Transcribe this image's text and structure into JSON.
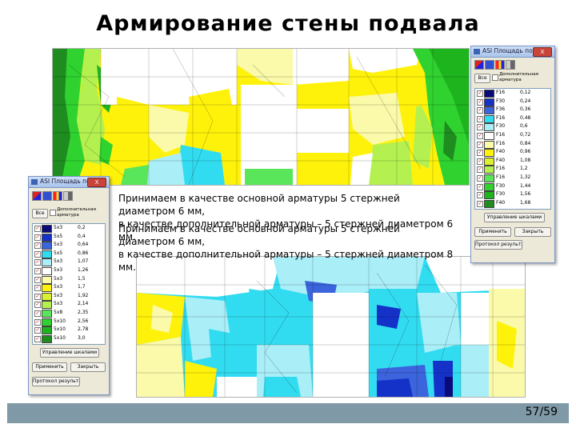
{
  "slide": {
    "title": "Армирование стены подвала",
    "page_number": "57/59"
  },
  "overlay_text": {
    "back": "Принимаем в качестве основной арматуры 5 стержней\nдиаметром 6 мм,\nв качестве дополнительной арматуры – 5 стержней диаметром 6\nмм.",
    "front": "Принимаем в качестве основной арматуры 5 стержней\nдиаметром 6 мм,\nв качестве дополнительной арматуры – 5 стержней диаметром 8\nмм."
  },
  "colors": {
    "dark_green": "#1e8c1e",
    "green": "#2fd22f",
    "light_green": "#b4f050",
    "yellow": "#fff20a",
    "light_yellow": "#fafaaa",
    "cyan": "#32dcf0",
    "light_cyan": "#aaeef8",
    "blue": "#1432c8",
    "dark_blue": "#0a0a78",
    "footer": "#7f9aa6"
  },
  "window_x": {
    "title": "ASI Площадь по X",
    "close_label": "X",
    "all_label": "Все",
    "add_label": "Дополнительная арматура",
    "rows": [
      {
        "code": "F16",
        "value": "0,12",
        "color": "#0a0a78"
      },
      {
        "code": "F30",
        "value": "0,24",
        "color": "#1432c8"
      },
      {
        "code": "F36",
        "value": "0,36",
        "color": "#3c64dc"
      },
      {
        "code": "F16",
        "value": "0,48",
        "color": "#32dcf0"
      },
      {
        "code": "F30",
        "value": "0,6",
        "color": "#aaeef8"
      },
      {
        "code": "F16",
        "value": "0,72",
        "color": "#ffffff"
      },
      {
        "code": "F16",
        "value": "0,84",
        "color": "#fafaaa"
      },
      {
        "code": "F40",
        "value": "0,96",
        "color": "#fff20a"
      },
      {
        "code": "F40",
        "value": "1,08",
        "color": "#dcf032"
      },
      {
        "code": "F16",
        "value": "1,2",
        "color": "#b4f050"
      },
      {
        "code": "F16",
        "value": "1,32",
        "color": "#5ae65a"
      },
      {
        "code": "F30",
        "value": "1,44",
        "color": "#2fd22f"
      },
      {
        "code": "F30",
        "value": "1,56",
        "color": "#1eb41e"
      },
      {
        "code": "F40",
        "value": "1,68",
        "color": "#1e8c1e"
      }
    ],
    "btn_primary": "Управление шкалами",
    "btn_apply": "Применить",
    "btn_close": "Закрыть",
    "btn_report": "Протокол результатов"
  },
  "window_y": {
    "title": "ASI Площадь по Y",
    "close_label": "X",
    "all_label": "Все",
    "add_label": "Дополнительная арматура",
    "rows": [
      {
        "code": "5x3",
        "value": "0,2",
        "color": "#0a0a78"
      },
      {
        "code": "5x5",
        "value": "0,4",
        "color": "#1432c8"
      },
      {
        "code": "5x3",
        "value": "0,64",
        "color": "#3c64dc"
      },
      {
        "code": "5x5",
        "value": "0,86",
        "color": "#32dcf0"
      },
      {
        "code": "5x3",
        "value": "1,07",
        "color": "#aaeef8"
      },
      {
        "code": "5x3",
        "value": "1,26",
        "color": "#ffffff"
      },
      {
        "code": "5x3",
        "value": "1,5",
        "color": "#fafaaa"
      },
      {
        "code": "5x3",
        "value": "1,7",
        "color": "#fff20a"
      },
      {
        "code": "5x3",
        "value": "1,92",
        "color": "#dcf032"
      },
      {
        "code": "5x3",
        "value": "2,14",
        "color": "#b4f050"
      },
      {
        "code": "5x8",
        "value": "2,35",
        "color": "#5ae65a"
      },
      {
        "code": "5x10",
        "value": "2,56",
        "color": "#2fd22f"
      },
      {
        "code": "5x10",
        "value": "2,78",
        "color": "#1eb41e"
      },
      {
        "code": "5x10",
        "value": "3,0",
        "color": "#1e8c1e"
      }
    ],
    "btn_primary": "Управление шкалами",
    "btn_apply": "Применить",
    "btn_close": "Закрыть",
    "btn_report": "Протокол результатов"
  }
}
